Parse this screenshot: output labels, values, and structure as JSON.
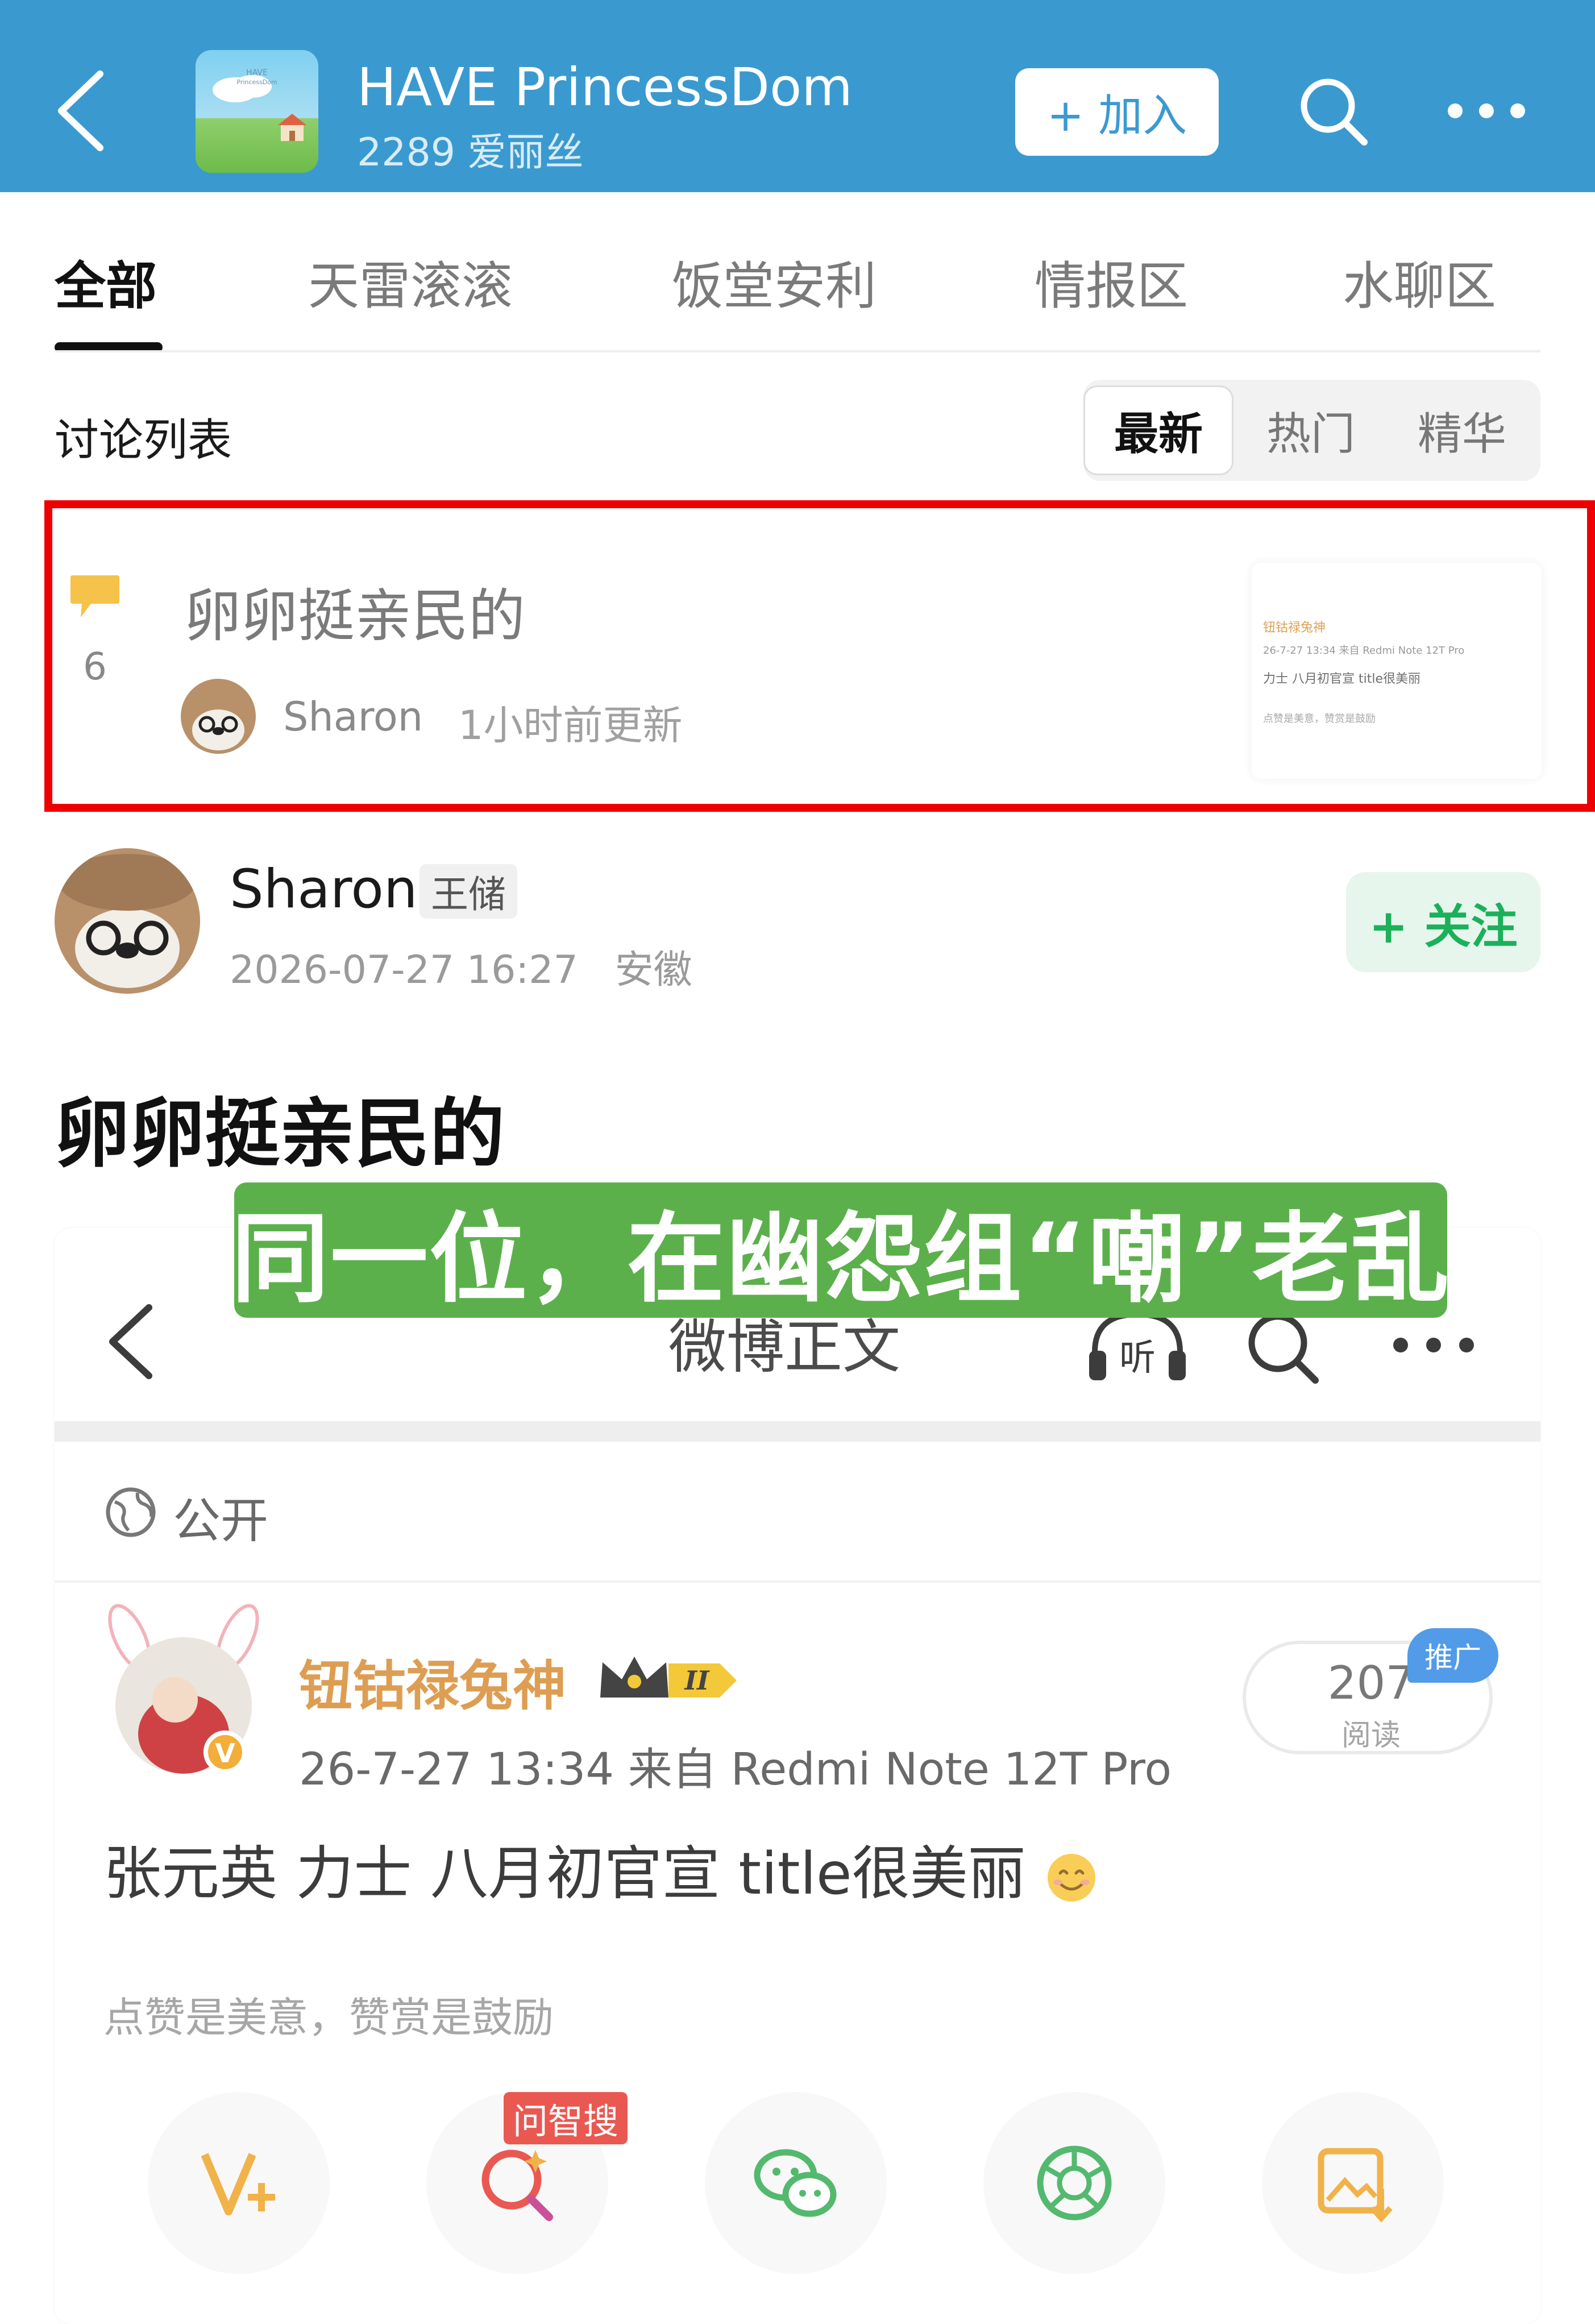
{
  "header": {
    "title": "HAVE PrincessDom",
    "subtitle": "2289 爱丽丝",
    "join_label": "+ 加入",
    "avatar_text": "HAVE PrincessDom",
    "bg_color": "#3a9ad0",
    "icons": [
      "back-arrow-icon",
      "search-icon",
      "more-dots-icon"
    ]
  },
  "tabs": [
    {
      "label": "全部",
      "active": true
    },
    {
      "label": "天雷滚滚",
      "active": false
    },
    {
      "label": "饭堂安利",
      "active": false
    },
    {
      "label": "情报区",
      "active": false
    },
    {
      "label": "水聊区",
      "active": false
    }
  ],
  "list": {
    "title": "讨论列表",
    "sort": [
      {
        "label": "最新",
        "active": true
      },
      {
        "label": "热门",
        "active": false
      },
      {
        "label": "精华",
        "active": false
      }
    ]
  },
  "thread": {
    "title": "卵卵挺亲民的",
    "comment_count": "6",
    "author": "Sharon",
    "updated": "1小时前更新",
    "highlight_color": "#ee0000",
    "thumbnail": {
      "line1": "钮钴禄兔神",
      "line2": "26-7-27 13:34  来自 Redmi Note 12T Pro",
      "line3": "力士  八月初官宣  title很美丽",
      "line4": "点赞是美意，赞赏是鼓励"
    }
  },
  "post": {
    "author": "Sharon",
    "badge": "王储",
    "time": "2026-07-27 16:27",
    "location": "安徽",
    "follow_label": "+ 关注",
    "title": "卵卵挺亲民的"
  },
  "caption": "同一位，在幽怨组“嘲”老乱",
  "embed": {
    "nav_title": "微博正文",
    "listen_label": "听",
    "visibility": "公开",
    "weibo": {
      "name": "钮钴禄兔神",
      "level": "II",
      "meta": "26-7-27 13:34   来自 Redmi Note 12T Pro",
      "reads": "207",
      "reads_label": "阅读",
      "promo": "推广",
      "text": "张元英  力士  八月初官宣  title很美丽",
      "encourage": "点赞是美意，赞赏是鼓励",
      "zhisou_badge": "问智搜",
      "actions": [
        "v-plus-icon",
        "zhisou-search-icon",
        "wechat-icon",
        "moments-icon",
        "save-image-icon"
      ]
    }
  },
  "colors": {
    "follow_green": "#1bb05a",
    "caption_green": "#5cb04c",
    "weibo_name": "#d9913c"
  }
}
